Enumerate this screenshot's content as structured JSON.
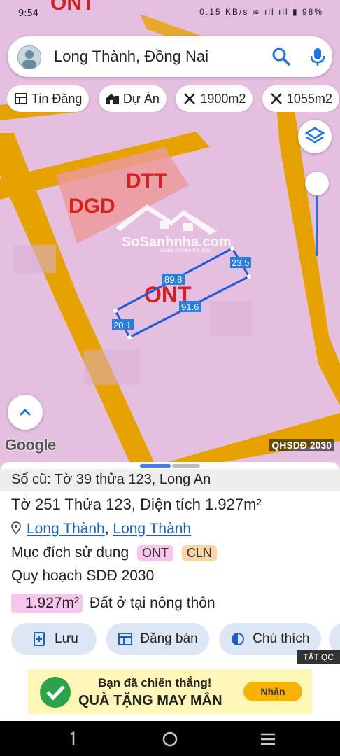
{
  "status": {
    "time": "9:54",
    "icons_text": "0.15 KB/s  ≋ ıll ıll ▮ 98%"
  },
  "map": {
    "labels": {
      "ont_top": "ONT",
      "dtt": "DTT",
      "dgd": "DGD",
      "ont_main": "ONT"
    },
    "watermark_brand": "SoSanhnha.com",
    "watermark_tag": "Great choice for you",
    "edges": {
      "top": "89.8",
      "right": "23.5",
      "bottom": "91.6",
      "left": "20.1"
    },
    "attribution": "Google",
    "layer_name": "QHSDĐ 2030",
    "colors": {
      "zone": "#e4bfe0",
      "road": "#e6a300",
      "facility": "#ec9a9a",
      "outline": "#1f5bd6"
    }
  },
  "search": {
    "query": "Long Thành, Đồng Nai"
  },
  "chips": [
    {
      "label": "Tin Đăng",
      "icon": "news-icon"
    },
    {
      "label": "Dự Án",
      "icon": "building-icon"
    },
    {
      "label": "1900m2",
      "icon": "area-icon"
    },
    {
      "label": "1055m2",
      "icon": "area-icon"
    }
  ],
  "sheet": {
    "old_label": "Số cũ: Tờ 39 thửa 123, Long An",
    "parcel": "Tờ 251 Thửa 123, Diện tích 1.927m²",
    "loc_a": "Long Thành",
    "loc_sep": ", ",
    "loc_b": "Long Thành",
    "purpose_label": "Mục đích sử dụng",
    "purpose_badges": [
      "ONT",
      "CLN"
    ],
    "plan_label": "Quy hoạch SDĐ 2030",
    "area_badge": "1.927m²",
    "area_desc": "Đất ở tại nông thôn",
    "buttons": [
      "Lưu",
      "Đăng bán",
      "Chú thích"
    ]
  },
  "ad": {
    "close_label": "TẮT QC",
    "line1": "Bạn đã chiến thắng!",
    "line2": "QUÀ TẶNG MAY MẮN",
    "cta": "Nhận"
  }
}
